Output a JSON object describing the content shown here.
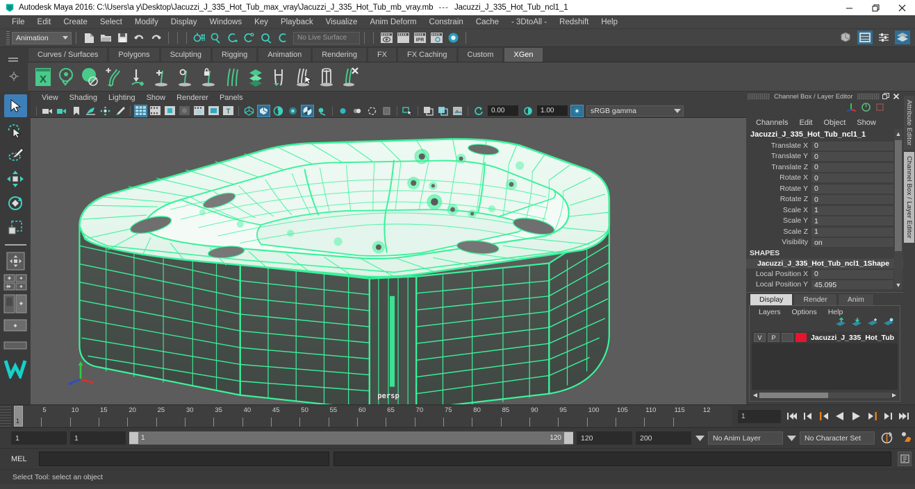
{
  "titlebar": {
    "app_title": "Autodesk Maya 2016: C:\\Users\\a y\\Desktop\\Jacuzzi_J_335_Hot_Tub_max_vray\\Jacuzzi_J_335_Hot_Tub_mb_vray.mb",
    "separator": "---",
    "selected_object": "Jacuzzi_J_335_Hot_Tub_ncl1_1",
    "minimize": "—",
    "maximize": "❐",
    "close": "✕"
  },
  "menubar": {
    "items": [
      "File",
      "Edit",
      "Create",
      "Select",
      "Modify",
      "Display",
      "Windows",
      "Key",
      "Playback",
      "Visualize",
      "Anim Deform",
      "Constrain",
      "Cache",
      "- 3DtoAll -",
      "Redshift",
      "Help"
    ]
  },
  "statusline": {
    "menuset": "Animation",
    "live_surface": "No Live Surface"
  },
  "shelf": {
    "tabs": [
      "Curves / Surfaces",
      "Polygons",
      "Sculpting",
      "Rigging",
      "Animation",
      "Rendering",
      "FX",
      "FX Caching",
      "Custom",
      "XGen"
    ],
    "active_tab": "XGen"
  },
  "viewport": {
    "menus": [
      "View",
      "Shading",
      "Lighting",
      "Show",
      "Renderer",
      "Panels"
    ],
    "exposure_value": "0.00",
    "gamma_value": "1.00",
    "color_profile": "sRGB gamma",
    "camera_label": "persp",
    "background_color": "#5c5c5c",
    "wireframe_color": "#3bf29a",
    "surface_color": "#e8f7ef"
  },
  "channelbox": {
    "panel_title": "Channel Box / Layer Editor",
    "menus": [
      "Channels",
      "Edit",
      "Object",
      "Show"
    ],
    "object_name": "Jacuzzi_J_335_Hot_Tub_ncl1_1",
    "attributes": [
      {
        "label": "Translate X",
        "value": "0"
      },
      {
        "label": "Translate Y",
        "value": "0"
      },
      {
        "label": "Translate Z",
        "value": "0"
      },
      {
        "label": "Rotate X",
        "value": "0"
      },
      {
        "label": "Rotate Y",
        "value": "0"
      },
      {
        "label": "Rotate Z",
        "value": "0"
      },
      {
        "label": "Scale X",
        "value": "1"
      },
      {
        "label": "Scale Y",
        "value": "1"
      },
      {
        "label": "Scale Z",
        "value": "1"
      },
      {
        "label": "Visibility",
        "value": "on"
      }
    ],
    "shapes_header": "SHAPES",
    "shape_name": "Jacuzzi_J_335_Hot_Tub_ncl1_1Shape",
    "shape_attributes": [
      {
        "label": "Local Position X",
        "value": "0"
      },
      {
        "label": "Local Position Y",
        "value": "45.095"
      }
    ]
  },
  "layereditor": {
    "tabs": [
      "Display",
      "Render",
      "Anim"
    ],
    "active_tab": "Display",
    "menus": [
      "Layers",
      "Options",
      "Help"
    ],
    "layers": [
      {
        "visibility": "V",
        "playback": "P",
        "extra": "",
        "color": "#e8142d",
        "name": "Jacuzzi_J_335_Hot_Tub"
      }
    ]
  },
  "vertical_tabs": {
    "items": [
      "Attribute Editor",
      "Channel Box / Layer Editor"
    ],
    "active": "Channel Box / Layer Editor"
  },
  "timeslider": {
    "ticks": [
      5,
      10,
      15,
      20,
      25,
      30,
      35,
      40,
      45,
      50,
      55,
      60,
      65,
      70,
      75,
      80,
      85,
      90,
      95,
      100,
      105,
      110,
      115
    ],
    "last_partial_label": "12",
    "current_frame": "1",
    "current_frame_field": "1",
    "range_start": 1,
    "range_end": 120
  },
  "rangeslider": {
    "anim_start": "1",
    "playback_start": "1",
    "bar_start_value": "1",
    "bar_end_value": "120",
    "playback_end": "120",
    "anim_end": "200",
    "anim_layer": "No Anim Layer",
    "character_set": "No Character Set"
  },
  "commandline": {
    "mel_label": "MEL",
    "input_value": "",
    "output_value": ""
  },
  "helpline": {
    "text": "Select Tool: select an object"
  }
}
